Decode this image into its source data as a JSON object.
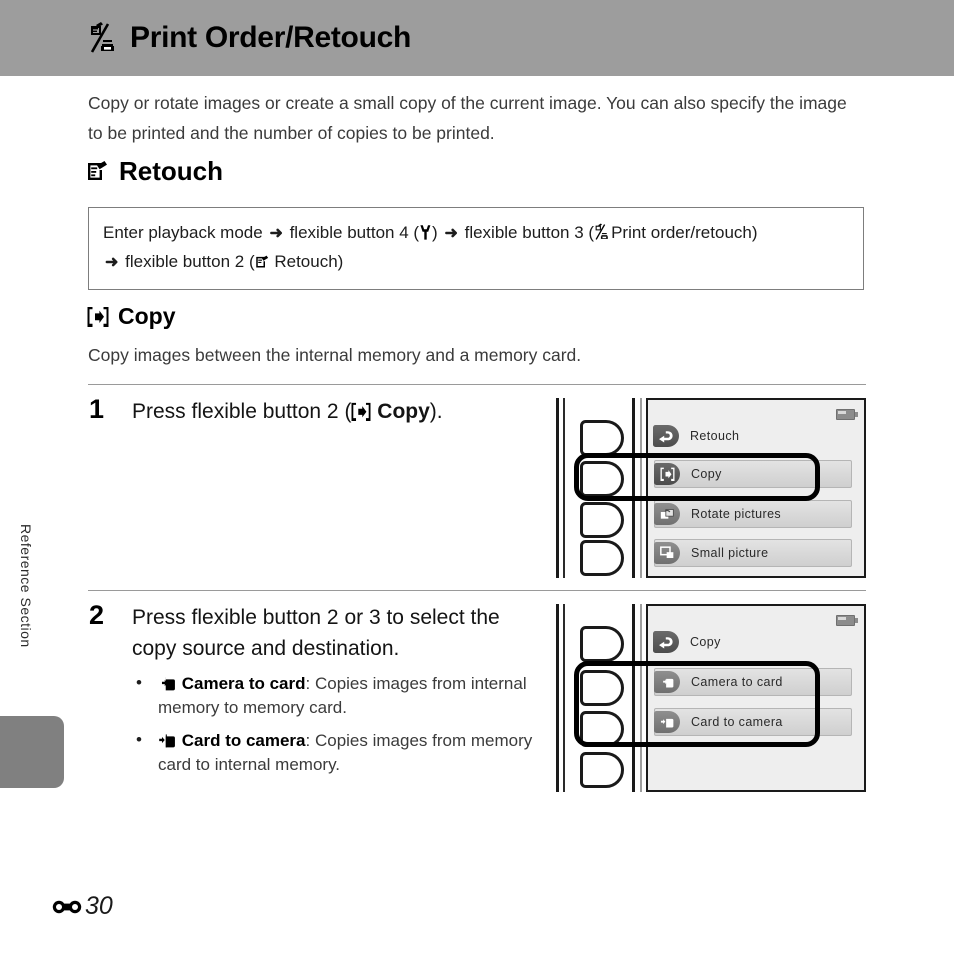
{
  "header": {
    "title": "Print Order/Retouch",
    "icon": "print-order-retouch-icon"
  },
  "intro": "Copy or rotate images or create a small copy of the current image. You can also specify the image to be printed and the number of copies to be printed.",
  "retouch_section": {
    "heading": "Retouch",
    "icon": "retouch-icon",
    "navbox": {
      "part1": "Enter playback mode",
      "arrow": "➜",
      "part2": "flexible button 4 (",
      "wrench_icon": "wrench-icon",
      "part3": ")",
      "part4": "flexible button 3 (",
      "print_icon": "print-order-retouch-icon",
      "part5": "Print order/retouch)",
      "part6": "flexible button 2 (",
      "retouch_icon": "retouch-icon",
      "part7": "Retouch)"
    }
  },
  "copy_section": {
    "heading": "Copy",
    "icon": "copy-icon",
    "description": "Copy images between the internal memory and a memory card."
  },
  "steps": [
    {
      "number": "1",
      "text_before": "Press flexible button 2 (",
      "icon": "copy-icon",
      "text_bold": "Copy",
      "text_after": ").",
      "screen": {
        "title_row": {
          "label": "Retouch",
          "icon": "back-arrow-icon"
        },
        "battery_icon": "battery-icon",
        "rows": [
          {
            "label": "Copy",
            "icon": "copy-icon",
            "highlighted": true
          },
          {
            "label": "Rotate pictures",
            "icon": "rotate-pictures-icon",
            "highlighted": false
          },
          {
            "label": "Small picture",
            "icon": "small-picture-icon",
            "highlighted": false
          }
        ]
      }
    },
    {
      "number": "2",
      "text": "Press flexible button 2 or 3 to select the copy source and destination.",
      "bullets": [
        {
          "icon": "camera-to-card-icon",
          "label": "Camera to card",
          "separator": ": ",
          "description": "Copies images from internal memory to memory card."
        },
        {
          "icon": "card-to-camera-icon",
          "label": "Card to camera",
          "separator": ": ",
          "description": "Copies images from memory card to internal memory."
        }
      ],
      "screen": {
        "title_row": {
          "label": "Copy",
          "icon": "back-arrow-icon"
        },
        "battery_icon": "battery-icon",
        "rows": [
          {
            "label": "Camera to card",
            "icon": "camera-to-card-icon",
            "highlighted": true
          },
          {
            "label": "Card to camera",
            "icon": "card-to-camera-icon",
            "highlighted": true
          }
        ]
      }
    }
  ],
  "side_label": "Reference Section",
  "footer": {
    "section_symbol": "reference-section-icon",
    "page_number": "30"
  }
}
